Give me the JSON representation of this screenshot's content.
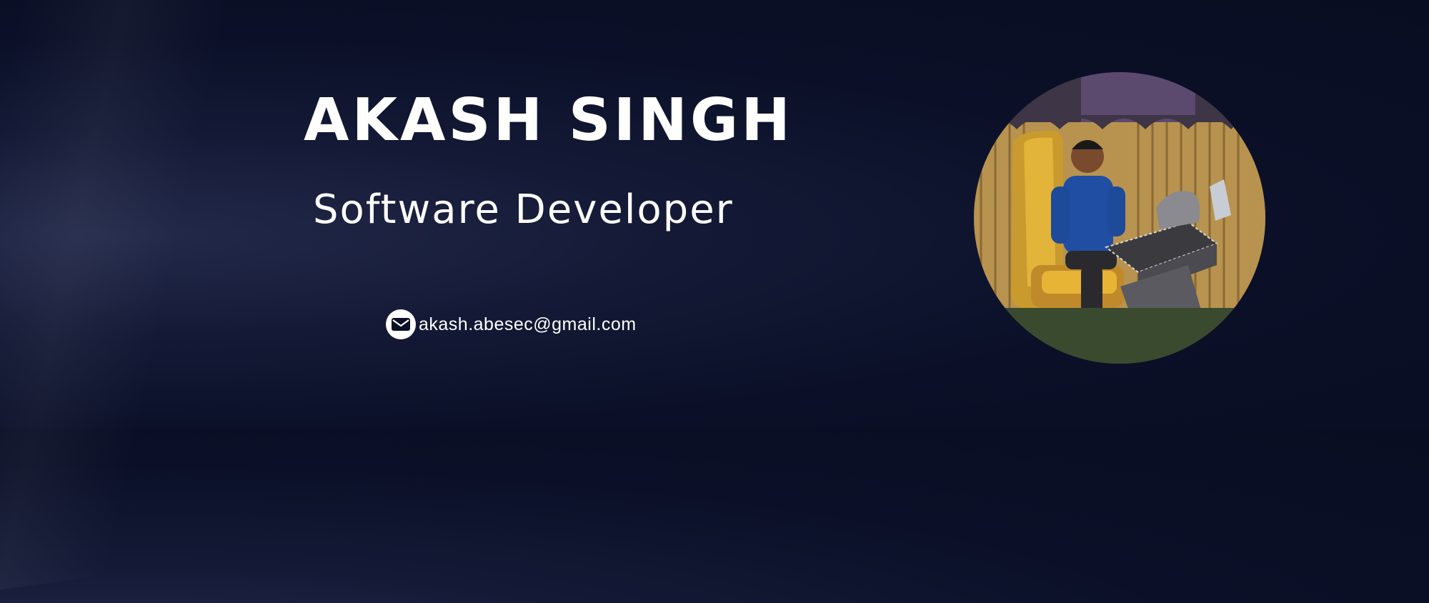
{
  "profile": {
    "name": "AKASH SINGH",
    "title": "Software Developer",
    "email": "akash.abesec@gmail.com"
  },
  "icons": {
    "email": "envelope-icon"
  },
  "colors": {
    "background": "#0b1028",
    "text": "#ffffff",
    "icon_background": "#ffffff"
  }
}
